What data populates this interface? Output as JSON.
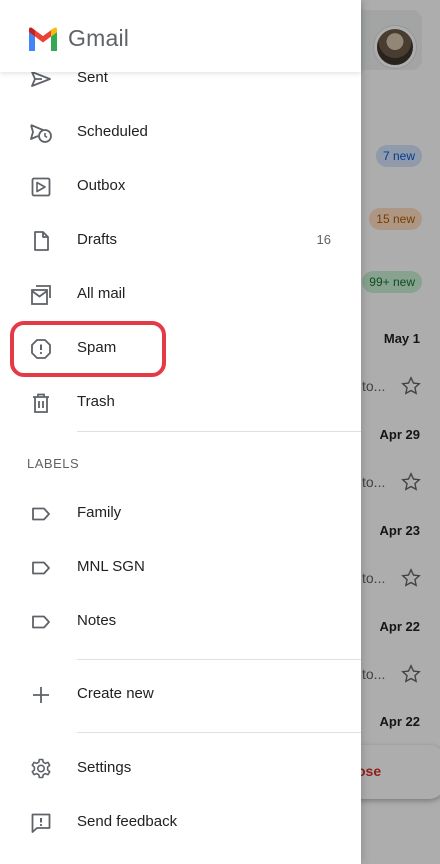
{
  "app": {
    "name": "Gmail"
  },
  "background": {
    "badges": [
      {
        "text": "7 new",
        "color": "#0b57d0"
      },
      {
        "text": "15 new",
        "color": "#b05b00"
      },
      {
        "text": "99+ new",
        "color": "#137333"
      }
    ],
    "mail_rows": [
      {
        "date": "May 1",
        "snippet": "to..."
      },
      {
        "date": "Apr 29",
        "snippet": "to..."
      },
      {
        "date": "Apr 23",
        "snippet": "to..."
      },
      {
        "date": "Apr 22",
        "snippet": "to..."
      },
      {
        "date": "Apr 22",
        "snippet": ""
      }
    ],
    "compose_label": "ose"
  },
  "nav": {
    "sent": {
      "label": "Sent",
      "icon": "send-icon"
    },
    "scheduled": {
      "label": "Scheduled",
      "icon": "scheduled-send-icon"
    },
    "outbox": {
      "label": "Outbox",
      "icon": "outbox-icon"
    },
    "drafts": {
      "label": "Drafts",
      "icon": "draft-file-icon",
      "count": "16"
    },
    "all_mail": {
      "label": "All mail",
      "icon": "all-mail-icon"
    },
    "spam": {
      "label": "Spam",
      "icon": "spam-alert-icon",
      "highlighted": true,
      "highlight_color": "#e63946"
    },
    "trash": {
      "label": "Trash",
      "icon": "trash-icon"
    }
  },
  "labels_section": {
    "title": "LABELS",
    "items": [
      {
        "label": "Family",
        "icon": "label-icon"
      },
      {
        "label": "MNL SGN",
        "icon": "label-icon"
      },
      {
        "label": "Notes",
        "icon": "label-icon"
      }
    ],
    "create_new": {
      "label": "Create new",
      "icon": "plus-icon"
    }
  },
  "footer": {
    "settings": {
      "label": "Settings",
      "icon": "gear-icon"
    },
    "feedback": {
      "label": "Send feedback",
      "icon": "feedback-icon"
    }
  }
}
